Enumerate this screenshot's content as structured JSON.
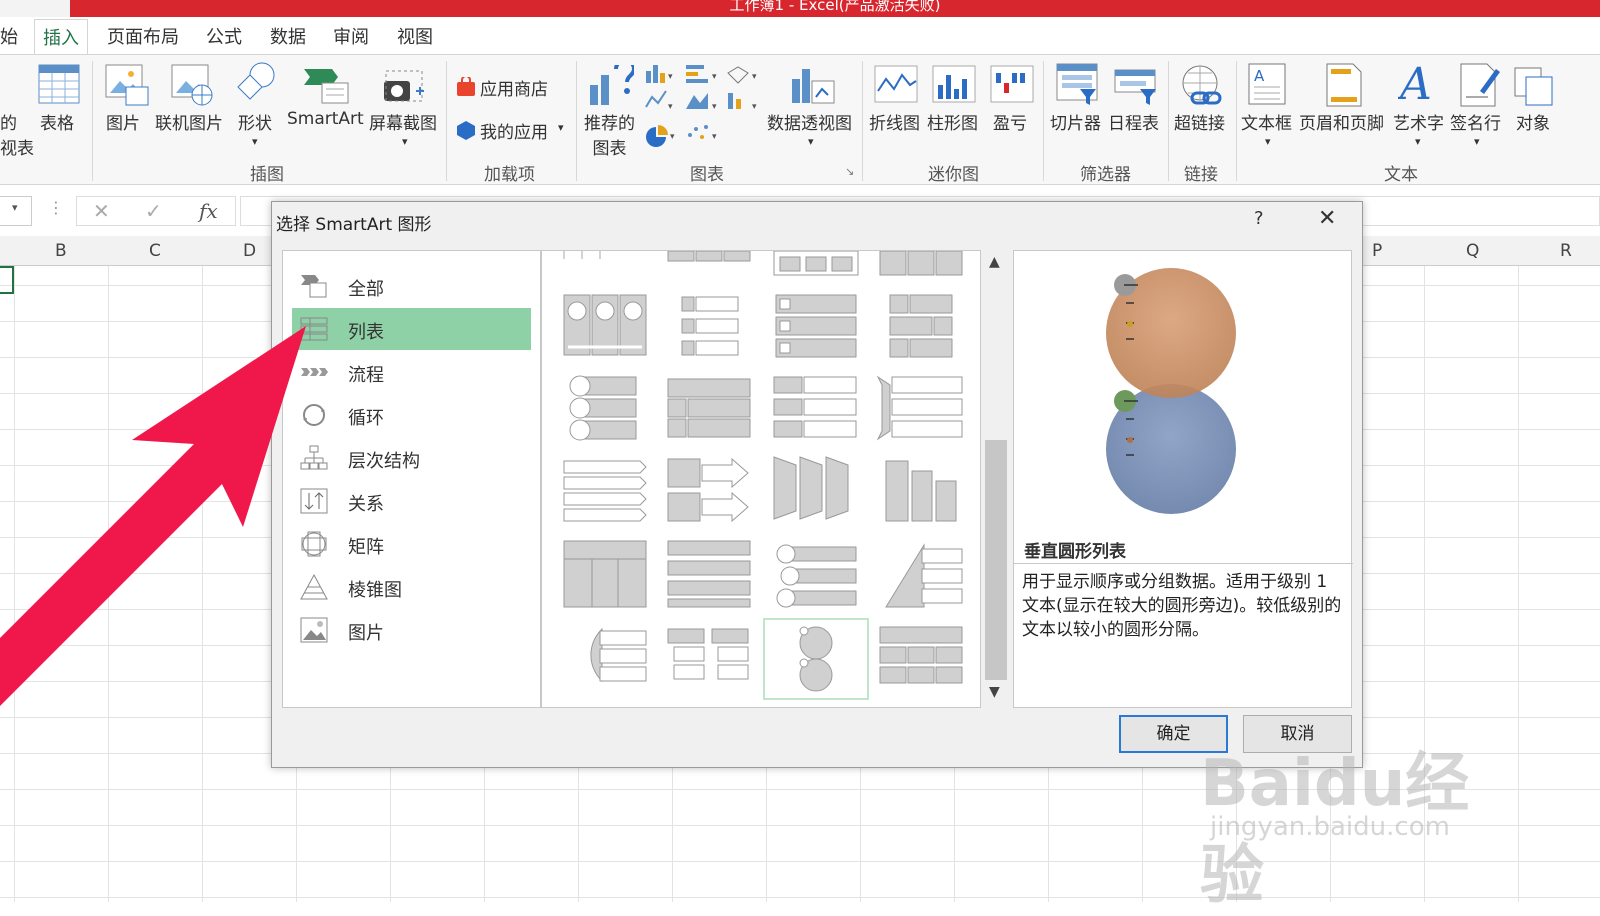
{
  "window": {
    "title": "工作簿1 - Excel(产品激活失败)"
  },
  "tabs": [
    {
      "label": "始"
    },
    {
      "label": "插入",
      "active": true
    },
    {
      "label": "页面布局"
    },
    {
      "label": "公式"
    },
    {
      "label": "数据"
    },
    {
      "label": "审阅"
    },
    {
      "label": "视图"
    }
  ],
  "ribbon": {
    "partial_left": {
      "line1": "的",
      "line2": "视表"
    },
    "table": "表格",
    "picture": "图片",
    "online_picture": "联机图片",
    "shapes": "形状",
    "smartart": "SmartArt",
    "screenshot": "屏幕截图",
    "app_store": "应用商店",
    "my_apps": "我的应用",
    "recommended_charts": {
      "line1": "推荐的",
      "line2": "图表"
    },
    "pivot_chart": "数据透视图",
    "spark_line": "折线图",
    "spark_column": "柱形图",
    "spark_winloss": "盈亏",
    "slicer": "切片器",
    "timeline": "日程表",
    "hyperlink": "超链接",
    "textbox": "文本框",
    "header_footer": "页眉和页脚",
    "wordart": "艺术字",
    "signature": "签名行",
    "object": "对象",
    "groups": {
      "illustrations": "插图",
      "addins": "加载项",
      "charts": "图表",
      "sparklines": "迷你图",
      "filters": "筛选器",
      "links": "链接",
      "text": "文本"
    }
  },
  "formula_bar": {
    "fx": "fx"
  },
  "columns": [
    "B",
    "C",
    "D",
    "P",
    "Q",
    "R"
  ],
  "dialog": {
    "title": "选择 SmartArt 图形",
    "help": "?",
    "close": "✕",
    "categories": [
      {
        "label": "全部"
      },
      {
        "label": "列表",
        "selected": true
      },
      {
        "label": "流程"
      },
      {
        "label": "循环"
      },
      {
        "label": "层次结构"
      },
      {
        "label": "关系"
      },
      {
        "label": "矩阵"
      },
      {
        "label": "棱锥图"
      },
      {
        "label": "图片"
      }
    ],
    "preview": {
      "name": "垂直圆形列表",
      "description": "用于显示顺序或分组数据。适用于级别 1 文本(显示在较大的圆形旁边)。较低级别的文本以较小的圆形分隔。"
    },
    "ok": "确定",
    "cancel": "取消"
  },
  "watermark": {
    "main": "Baidu经验",
    "sub": "jingyan.baidu.com"
  },
  "colors": {
    "excel_green": "#217346",
    "title_red": "#d8262f",
    "selection_green": "#8fd1a6",
    "arrow": "#f0184a"
  }
}
